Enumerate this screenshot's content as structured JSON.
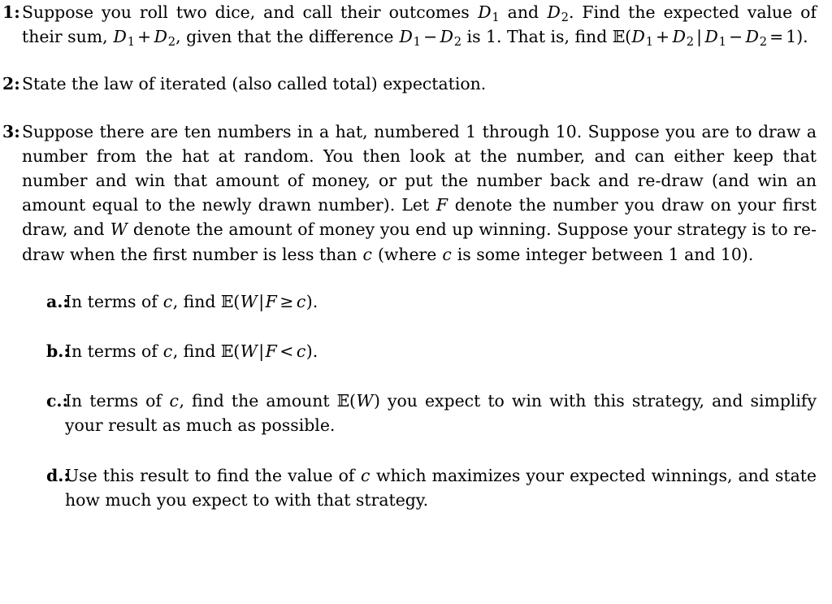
{
  "document": {
    "type": "problem-set",
    "background_color": "#ffffff",
    "text_color": "#000000"
  },
  "problems": [
    {
      "number": "1:",
      "text_part_1": "Suppose you roll two dice, and call their outcomes ",
      "math_d1_a": "D",
      "math_d1_a_sub": "1",
      "text_part_2": " and ",
      "math_d2_a": "D",
      "math_d2_a_sub": "2",
      "text_part_3": ". Find the expected value of their sum, ",
      "math_d1_b": "D",
      "math_d1_b_sub": "1",
      "op_plus": "+",
      "math_d2_b": "D",
      "math_d2_b_sub": "2",
      "text_part_4": ", given that the difference ",
      "math_d1_c": "D",
      "math_d1_c_sub": "1",
      "op_minus": "−",
      "math_d2_c": "D",
      "math_d2_c_sub": "2",
      "text_part_5": " is 1. That is, find ",
      "expr_E": "𝔼",
      "expr_open": "(",
      "expr_d1_d": "D",
      "expr_d1_d_sub": "1",
      "expr_plus": "+",
      "expr_d2_d": "D",
      "expr_d2_d_sub": "2",
      "expr_mid": "|",
      "expr_d1_e": "D",
      "expr_d1_e_sub": "1",
      "expr_minus": "−",
      "expr_d2_e": "D",
      "expr_d2_e_sub": "2",
      "expr_eq": "=",
      "expr_one": "1",
      "expr_close": ").",
      "plain_text": "Suppose you roll two dice, and call their outcomes D1 and D2. Find the expected value of their sum, D1 + D2, given that the difference D1 − D2 is 1. That is, find E(D1 + D2 | D1 − D2 = 1)."
    },
    {
      "number": "2:",
      "text": "State the law of iterated (also called total) expectation."
    },
    {
      "number": "3:",
      "text_part_1": "Suppose there are ten numbers in a hat, numbered 1 through 10. Suppose you are to draw a number from the hat at random. You then look at the number, and can either keep that number and win that amount of money, or put the number back and re-draw (and win an amount equal to the newly drawn number). Let ",
      "math_F": "F",
      "text_part_2": " denote the number you draw on your first draw, and ",
      "math_W": "W",
      "text_part_3": " denote the amount of money you end up winning. Suppose your strategy is to re-draw when the first number is less than ",
      "math_c_1": "c",
      "text_part_4": " (where ",
      "math_c_2": "c",
      "text_part_5": " is some integer between 1 and 10).",
      "plain_text": "Suppose there are ten numbers in a hat, numbered 1 through 10. Suppose you are to draw a number from the hat at random. You then look at the number, and can either keep that number and win that amount of money, or put the number back and re-draw (and win an amount equal to the newly drawn number). Let F denote the number you draw on your first draw, and W denote the amount of money you end up winning. Suppose your strategy is to re-draw when the first number is less than c (where c is some integer between 1 and 10)."
    }
  ],
  "subparts": [
    {
      "letter": "a.:",
      "text_part_1": "In terms of ",
      "math_c": "c",
      "text_part_2": ", find ",
      "expr_E": "𝔼",
      "expr_open": "(",
      "expr_W": "W",
      "expr_mid": "|",
      "expr_F": "F",
      "expr_rel": "≥",
      "expr_c": "c",
      "expr_close": ").",
      "plain_text": "In terms of c, find E(W|F ≥ c)."
    },
    {
      "letter": "b.:",
      "text_part_1": "In terms of ",
      "math_c": "c",
      "text_part_2": ", find ",
      "expr_E": "𝔼",
      "expr_open": "(",
      "expr_W": "W",
      "expr_mid": "|",
      "expr_F": "F",
      "expr_rel": "<",
      "expr_c": "c",
      "expr_close": ").",
      "plain_text": "In terms of c, find E(W|F < c)."
    },
    {
      "letter": "c.:",
      "text_part_1": "In terms of ",
      "math_c": "c",
      "text_part_2": ", find the amount ",
      "expr_E": "𝔼",
      "expr_open": "(",
      "expr_W": "W",
      "expr_close": ")",
      "text_part_3": " you expect to win with this strategy, and simplify your result as much as possible.",
      "plain_text": "In terms of c, find the amount E(W) you expect to win with this strategy, and simplify your result as much as possible."
    },
    {
      "letter": "d.:",
      "text_part_1": "Use this result to find the value of ",
      "math_c": "c",
      "text_part_2": " which maximizes your expected winnings, and state how much you expect to with that strategy.",
      "plain_text": "Use this result to find the value of c which maximizes your expected winnings, and state how much you expect to with that strategy."
    }
  ]
}
